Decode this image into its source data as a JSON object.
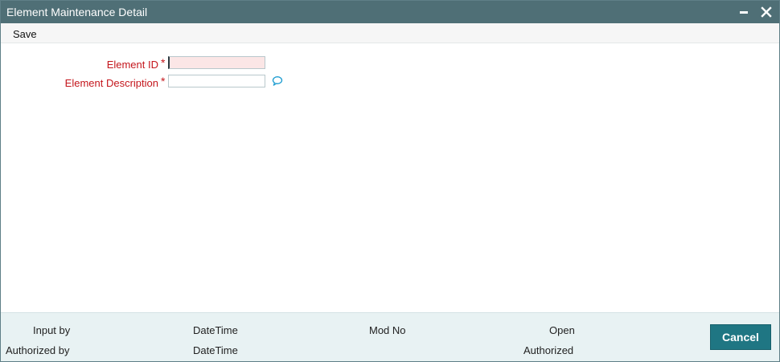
{
  "window": {
    "title": "Element Maintenance Detail"
  },
  "toolbar": {
    "save_label": "Save"
  },
  "form": {
    "element_id": {
      "label": "Element ID",
      "required_marker": "*",
      "value": ""
    },
    "element_description": {
      "label": "Element Description",
      "required_marker": "*",
      "value": ""
    }
  },
  "footer": {
    "input_by_label": "Input by",
    "authorized_by_label": "Authorized by",
    "datetime_label_1": "DateTime",
    "datetime_label_2": "DateTime",
    "mod_no_label": "Mod No",
    "open_label": "Open",
    "authorized_label": "Authorized",
    "cancel_label": "Cancel"
  },
  "icons": {
    "minimize": "minimize-icon",
    "close": "close-icon",
    "comment": "comment-icon"
  },
  "colors": {
    "titlebar": "#4f6f76",
    "label_red": "#c4161c",
    "footer_bg": "#e8f2f3",
    "cancel_button": "#1f7683",
    "focused_input_bg": "#fbe6e6"
  }
}
